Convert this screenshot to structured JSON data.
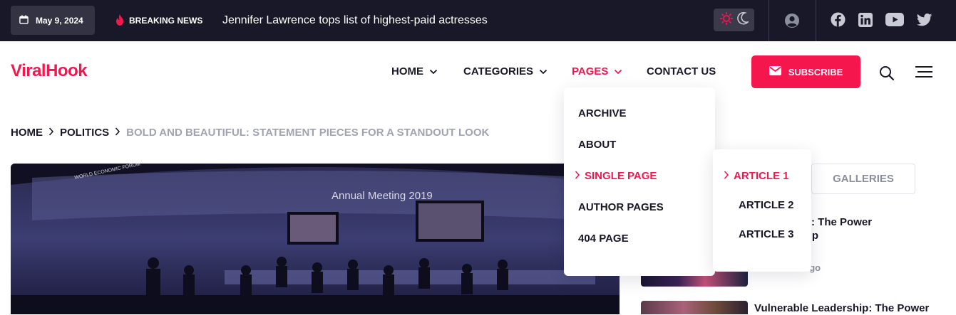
{
  "topbar": {
    "date": "May 9, 2024",
    "breaking_label": "BREAKING NEWS",
    "headline": "Jennifer Lawrence tops list of highest-paid actresses"
  },
  "brand": {
    "logo": "ViralHook",
    "accent": "#f5164e",
    "dark": "#181828"
  },
  "nav": {
    "items": [
      {
        "label": "HOME"
      },
      {
        "label": "CATEGORIES"
      },
      {
        "label": "PAGES"
      },
      {
        "label": "CONTACT US"
      }
    ],
    "subscribe": "SUBSCRIBE"
  },
  "pages_dropdown": {
    "items": [
      {
        "label": "ARCHIVE"
      },
      {
        "label": "ABOUT"
      },
      {
        "label": "SINGLE PAGE"
      },
      {
        "label": "AUTHOR PAGES"
      },
      {
        "label": "404 PAGE"
      }
    ],
    "submenu": [
      {
        "label": "ARTICLE 1"
      },
      {
        "label": "ARTICLE 2"
      },
      {
        "label": "ARTICLE 3"
      }
    ]
  },
  "breadcrumb": {
    "home": "HOME",
    "section": "POLITICS",
    "current": "BOLD AND BEAUTIFUL: STATEMENT PIECES FOR A STANDOUT LOOK"
  },
  "hero_image": {
    "stage_text": "Annual Meeting 2019",
    "forum_text": "WORLD ECONOMIC FORUM"
  },
  "sidebar": {
    "tab": "GALLERIES",
    "post1_title_line1": "Leadership: The Power",
    "post1_title_line2": "Up",
    "post1_meta": "ago",
    "post2_title": "Vulnerable Leadership: The Power"
  }
}
